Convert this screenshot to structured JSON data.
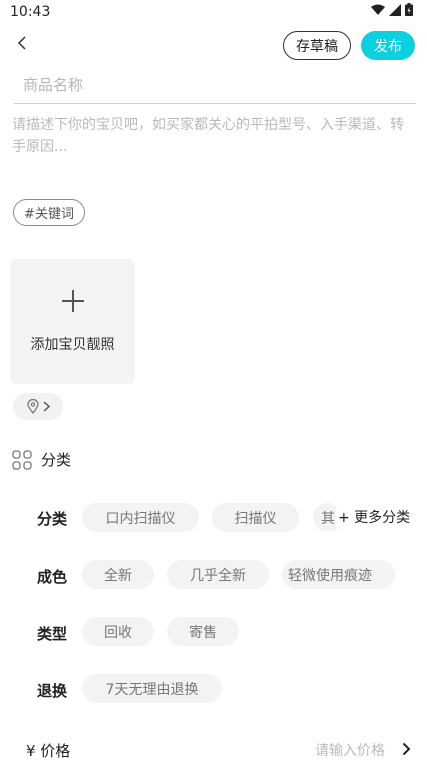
{
  "status": {
    "time": "10:43"
  },
  "header": {
    "draft_label": "存草稿",
    "publish_label": "发布"
  },
  "form": {
    "name_placeholder": "商品名称",
    "desc_placeholder": "请描述下你的宝贝吧，如买家都关心的平拍型号、入手渠道、转手原因...",
    "keyword_label": "#关键词",
    "photo_label": "添加宝贝靓照"
  },
  "category_section": {
    "title": "分类"
  },
  "rows": [
    {
      "label": "分类",
      "chips": [
        "口内扫描仪",
        "扫描仪",
        "其"
      ],
      "more": "+ 更多分类"
    },
    {
      "label": "成色",
      "chips": [
        "全新",
        "几乎全新",
        "轻微使用痕迹"
      ]
    },
    {
      "label": "类型",
      "chips": [
        "回收",
        "寄售"
      ]
    },
    {
      "label": "退换",
      "chips": [
        "7天无理由退换"
      ]
    }
  ],
  "price": {
    "label": "¥ 价格",
    "placeholder": "请输入价格"
  },
  "colors": {
    "accent": "#0ccfe0",
    "chip_bg": "#f2f3f5"
  }
}
